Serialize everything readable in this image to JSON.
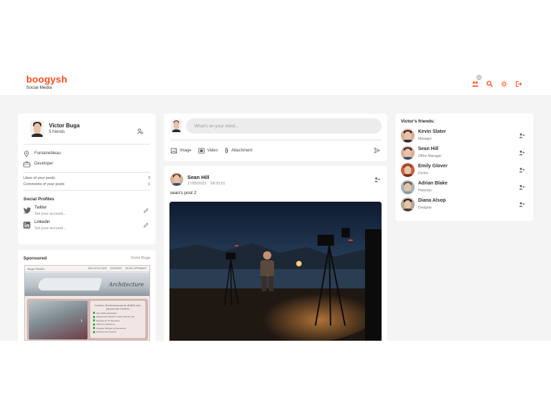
{
  "brand": {
    "title": "boogysh",
    "subtitle": "Social Media"
  },
  "header": {
    "notification_count": "0",
    "colors": {
      "accent": "#ff4d1a"
    }
  },
  "profile": {
    "name": "Victor Buga",
    "friends": "5 friends",
    "location": "Fontainebleau",
    "occupation": "Developer",
    "stats": [
      {
        "label": "Likes of your posts",
        "value": "3"
      },
      {
        "label": "Comments of your posts",
        "value": "1"
      }
    ],
    "social_title": "Social Profiles",
    "socials": [
      {
        "name": "Twitter",
        "value": "Set your account..."
      },
      {
        "name": "Linkedin",
        "value": "Set your account..."
      }
    ]
  },
  "sponsored": {
    "title": "Sponsored",
    "by": "Victor Buga",
    "ad": {
      "logo": "Bugo Studio",
      "nav": [
        "ARCHITECTURE",
        "INTERIOR",
        "DEVELOPPEMENT"
      ],
      "banner_word": "Architecture",
      "headline": "Centre d'entrainement dédié aux forces de l'ordre",
      "bullets": [
        "Plus 2000 participants",
        "Equipement Moderne: Vélos, Rames, Etc.",
        "Espaces de Tir Sécurisés",
        "Salle de Conférence",
        "Pratique Tactique et Intervention",
        "Entraînement Avancé"
      ]
    }
  },
  "composer": {
    "placeholder": "What's on your mind...",
    "actions": [
      "Image",
      "Video",
      "Attachment"
    ]
  },
  "post": {
    "author": "Sean Hill",
    "date": "17/05/2023",
    "time": "08:33:51",
    "text": "sean's post 2"
  },
  "friends": {
    "title": "Victor's friends:",
    "list": [
      {
        "name": "Kevin Slater",
        "role": "Manager"
      },
      {
        "name": "Sean Hill",
        "role": "Office Manager"
      },
      {
        "name": "Emily Glover",
        "role": "Doctor"
      },
      {
        "name": "Adrian Blake",
        "role": "Historian"
      },
      {
        "name": "Diana Alsop",
        "role": "Designer"
      }
    ]
  }
}
